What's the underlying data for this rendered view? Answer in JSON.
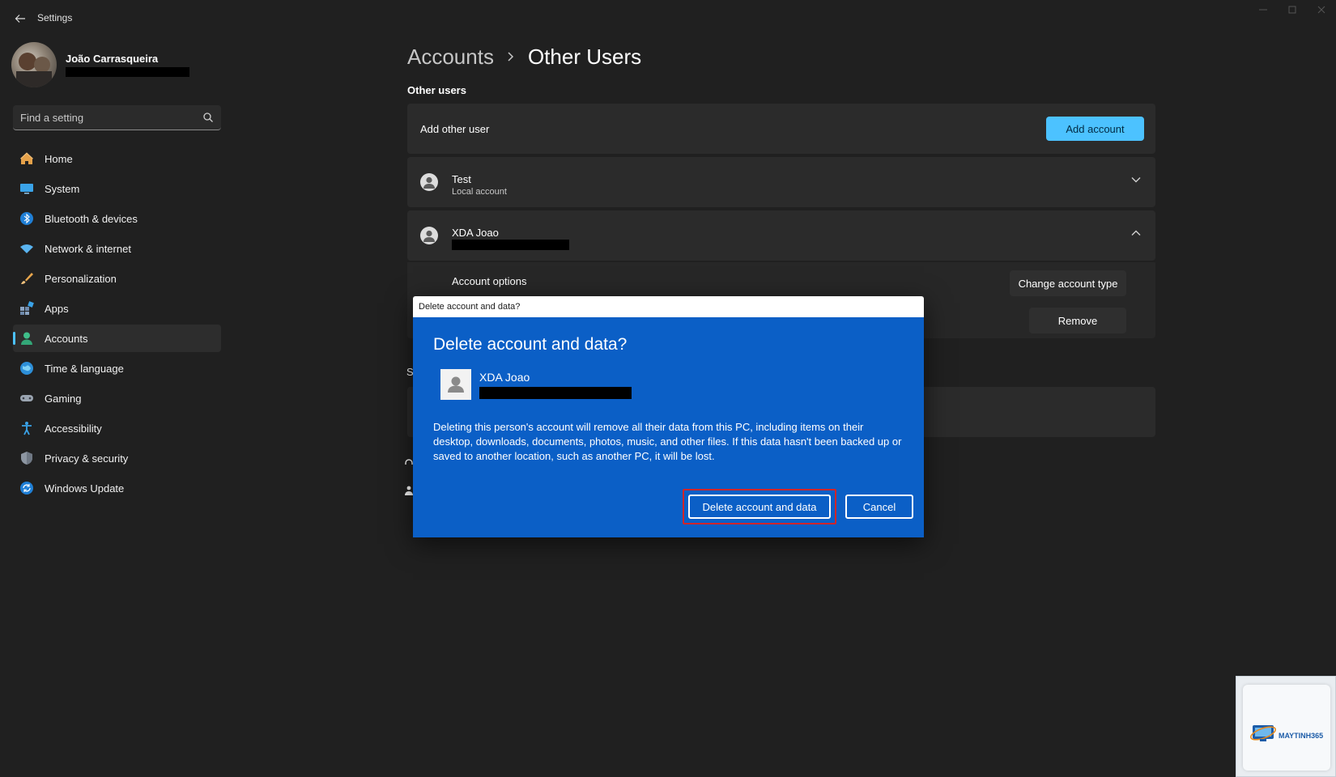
{
  "window": {
    "title": "Settings"
  },
  "profile": {
    "name": "João Carrasqueira"
  },
  "search": {
    "placeholder": "Find a setting"
  },
  "sidebar": {
    "items": [
      {
        "label": "Home",
        "icon": "home-icon"
      },
      {
        "label": "System",
        "icon": "system-icon"
      },
      {
        "label": "Bluetooth & devices",
        "icon": "bluetooth-icon"
      },
      {
        "label": "Network & internet",
        "icon": "wifi-icon"
      },
      {
        "label": "Personalization",
        "icon": "brush-icon"
      },
      {
        "label": "Apps",
        "icon": "apps-icon"
      },
      {
        "label": "Accounts",
        "icon": "accounts-icon",
        "active": true
      },
      {
        "label": "Time & language",
        "icon": "globe-icon"
      },
      {
        "label": "Gaming",
        "icon": "gamepad-icon"
      },
      {
        "label": "Accessibility",
        "icon": "accessibility-icon"
      },
      {
        "label": "Privacy & security",
        "icon": "shield-icon"
      },
      {
        "label": "Windows Update",
        "icon": "update-icon"
      }
    ]
  },
  "breadcrumb": {
    "parent": "Accounts",
    "current": "Other Users"
  },
  "main": {
    "section_title": "Other users",
    "add_user_label": "Add other user",
    "add_account_button": "Add account",
    "users": [
      {
        "name": "Test",
        "subtitle": "Local account"
      },
      {
        "name": "XDA Joao"
      }
    ],
    "account_options_label": "Account options",
    "change_account_type_button": "Change account type",
    "remove_button": "Remove",
    "partial_section_letter": "S"
  },
  "dialog": {
    "window_title": "Delete account and data?",
    "heading": "Delete account and data?",
    "user_name": "XDA Joao",
    "message": "Deleting this person's account will remove all their data from this PC, including items on their desktop, downloads, documents, photos, music, and other files. If this data hasn't been backed up or saved to another location, such as another PC, it will be lost.",
    "delete_button": "Delete account and data",
    "cancel_button": "Cancel"
  },
  "watermark": {
    "brand": "MAYTINH365"
  },
  "colors": {
    "background": "#202020",
    "card": "#2b2b2b",
    "accent": "#4cc2ff",
    "dialog_blue": "#0b5fc6",
    "highlight_red": "#d0252a"
  }
}
